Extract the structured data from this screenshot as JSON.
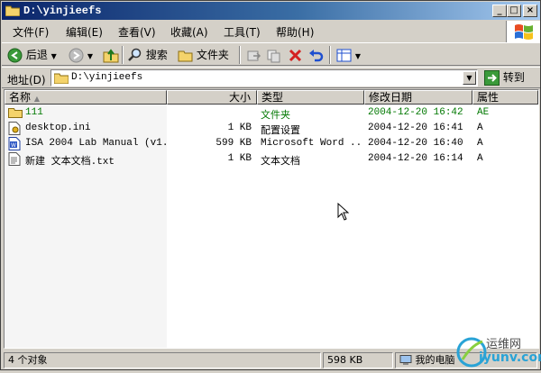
{
  "window": {
    "title": "D:\\yinjieefs"
  },
  "menu": [
    "文件(F)",
    "编辑(E)",
    "查看(V)",
    "收藏(A)",
    "工具(T)",
    "帮助(H)"
  ],
  "toolbar": {
    "back": "后退",
    "search": "搜索",
    "folders": "文件夹"
  },
  "address": {
    "label": "地址(D)",
    "value": "D:\\yinjieefs",
    "go": "转到"
  },
  "columns": {
    "name": "名称",
    "size": "大小",
    "type": "类型",
    "modified": "修改日期",
    "attributes": "属性"
  },
  "files": [
    {
      "name": "111",
      "size": "",
      "type": "文件夹",
      "modified": "2004-12-20 16:42",
      "attr": "AE",
      "icon": "folder-icon",
      "color": "#007800"
    },
    {
      "name": "desktop.ini",
      "size": "1 KB",
      "type": "配置设置",
      "modified": "2004-12-20 16:41",
      "attr": "A",
      "icon": "ini-file-icon",
      "color": "#000000"
    },
    {
      "name": "ISA 2004 Lab Manual (v1...",
      "size": "599 KB",
      "type": "Microsoft Word ...",
      "modified": "2004-12-20 16:40",
      "attr": "A",
      "icon": "word-document-icon",
      "color": "#000000"
    },
    {
      "name": "新建 文本文档.txt",
      "size": "1 KB",
      "type": "文本文档",
      "modified": "2004-12-20 16:14",
      "attr": "A",
      "icon": "text-file-icon",
      "color": "#000000"
    }
  ],
  "status": {
    "count": "4 个对象",
    "size": "598 KB",
    "location": "我的电脑"
  },
  "watermark": {
    "brand": "运维网",
    "url": "iyunv.com"
  }
}
